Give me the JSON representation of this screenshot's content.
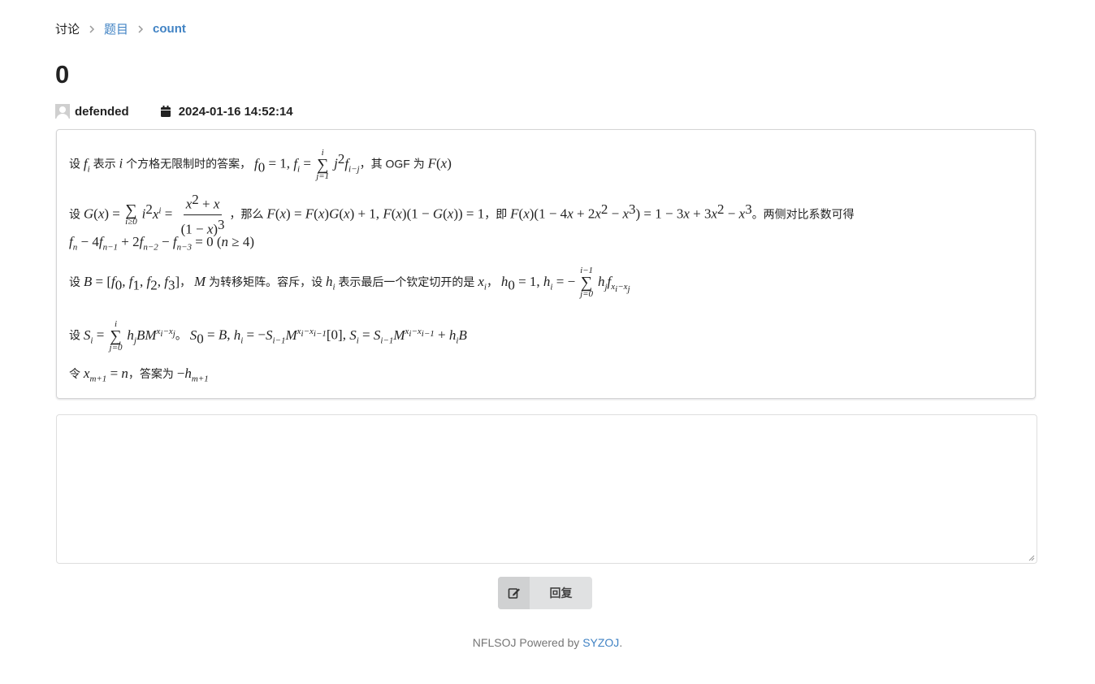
{
  "breadcrumb": {
    "root": "讨论",
    "problem": "题目",
    "current": "count"
  },
  "post": {
    "title": "0",
    "author": "defended",
    "date": "2024-01-16 14:52:14"
  },
  "content": {
    "l1_a": "设",
    "l1_b": "表示",
    "l1_c": "个方格无限制时的答案，",
    "l1_d": "，其 OGF 为",
    "l2_a": "设",
    "l2_b": "，那么",
    "l2_c": "，即",
    "l2_d": "。两侧对比系数可得",
    "l4_a": "设",
    "l4_b": "，",
    "l4_c": "为转移矩阵。容斥，设",
    "l4_d": "表示最后一个钦定切开的是",
    "l4_e": "，",
    "l5_a": "设",
    "l5_b": "。",
    "l6_a": "令",
    "l6_b": "，答案为"
  },
  "reply": {
    "button_label": "回复",
    "textarea_placeholder": ""
  },
  "footer": {
    "prefix": "NFLSOJ Powered by",
    "brand": "SYZOJ",
    "suffix": "."
  },
  "colors": {
    "link": "#4183c4",
    "button_bg": "#e0e1e2",
    "text": "#222222"
  }
}
